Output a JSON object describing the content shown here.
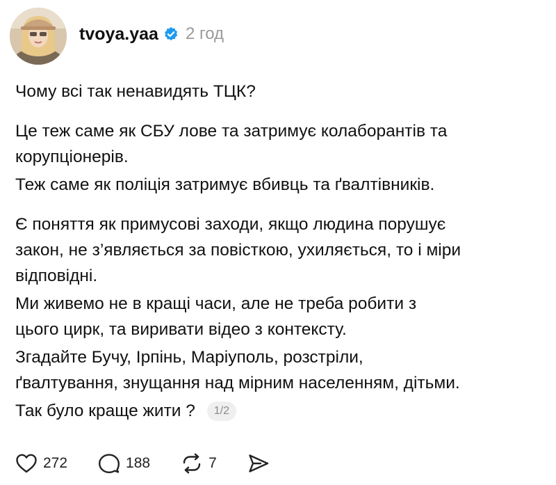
{
  "post": {
    "username": "tvoya.yaa",
    "time": "2 год",
    "verified_color": "#1d9bf0",
    "paragraphs": [
      [
        "Чому всі так ненавидять ТЦК?"
      ],
      [
        "Це теж саме як СБУ лове та затримує колаборантів та",
        "корупціонерів."
      ],
      [
        "Теж саме як поліція затримує вбивць та ґвалтівників."
      ],
      [
        "Є поняття як примусові заходи, якщо людина порушує",
        "закон, не з’являється за повісткою, ухиляється, то і міри",
        "відповідні."
      ],
      [
        "Ми живемо не в кращі часи, але не треба робити з",
        "цього цирк, та виривати відео з контексту."
      ],
      [
        "Згадайте Бучу, Ірпінь, Маріуполь, розстріли,",
        "ґвалтування, знущання над мірним населенням, дітьми."
      ],
      [
        "Так було краще жити ?"
      ]
    ],
    "page_indicator": "1/2"
  },
  "actions": {
    "like": {
      "icon": "heart-icon",
      "count": "272"
    },
    "comment": {
      "icon": "comment-icon",
      "count": "188"
    },
    "repost": {
      "icon": "repost-icon",
      "count": "7"
    },
    "share": {
      "icon": "send-icon"
    }
  }
}
